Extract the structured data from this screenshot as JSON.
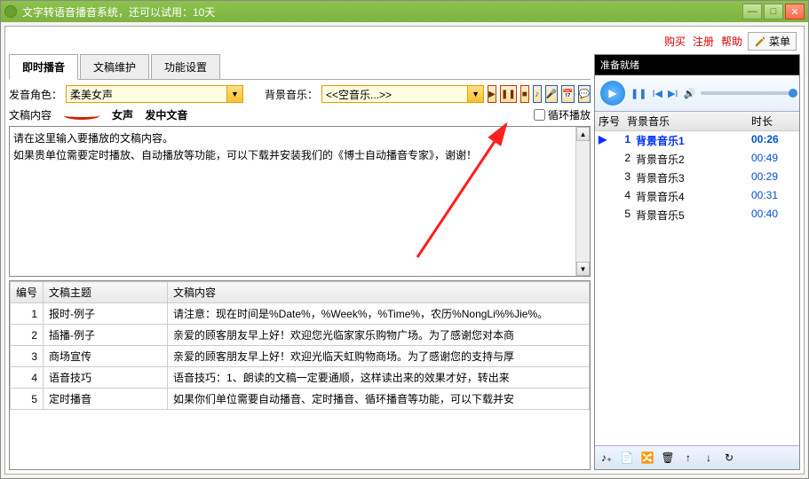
{
  "window": {
    "title": "文字转语音播音系统，还可以试用：10天"
  },
  "top_links": {
    "buy": "购买",
    "register": "注册",
    "help": "帮助",
    "menu": "菜单"
  },
  "tabs": {
    "t1": "即时播音",
    "t2": "文稿维护",
    "t3": "功能设置"
  },
  "voice": {
    "label": "发音角色：",
    "value": "柔美女声",
    "tag1": "女声",
    "tag2": "发中文音"
  },
  "bgm": {
    "label": "背景音乐：",
    "value": "<<空音乐...>>"
  },
  "loop": {
    "label": "循环播放"
  },
  "content_label": "文稿内容",
  "content_text": "请在这里输入要播放的文稿内容。\n如果贵单位需要定时播放、自动播放等功能，可以下载并安装我们的《博士自动播音专家》，谢谢！",
  "table": {
    "headers": {
      "num": "编号",
      "topic": "文稿主题",
      "content": "文稿内容"
    },
    "rows": [
      {
        "num": "1",
        "topic": "报时-例子",
        "content": "请注意：现在时间是%Date%，%Week%，%Time%，农历%NongLi%%Jie%。"
      },
      {
        "num": "2",
        "topic": "插播-例子",
        "content": "亲爱的顾客朋友早上好！欢迎您光临家家乐购物广场。为了感谢您对本商"
      },
      {
        "num": "3",
        "topic": "商场宣传",
        "content": "亲爱的顾客朋友早上好！欢迎光临天虹购物商场。为了感谢您的支持与厚"
      },
      {
        "num": "4",
        "topic": "语音技巧",
        "content": "语音技巧：1、朗读的文稿一定要通顺，这样读出来的效果才好，转出来"
      },
      {
        "num": "5",
        "topic": "定时播音",
        "content": "如果你们单位需要自动播音、定时播音、循环播音等功能，可以下载并安"
      }
    ]
  },
  "player": {
    "status": "准备就绪",
    "headers": {
      "num": "序号",
      "name": "背景音乐",
      "dur": "时长"
    },
    "items": [
      {
        "num": "1",
        "name": "背景音乐1",
        "dur": "00:26",
        "active": true
      },
      {
        "num": "2",
        "name": "背景音乐2",
        "dur": "00:49"
      },
      {
        "num": "3",
        "name": "背景音乐3",
        "dur": "00:29"
      },
      {
        "num": "4",
        "name": "背景音乐4",
        "dur": "00:31"
      },
      {
        "num": "5",
        "name": "背景音乐5",
        "dur": "00:40"
      }
    ]
  }
}
